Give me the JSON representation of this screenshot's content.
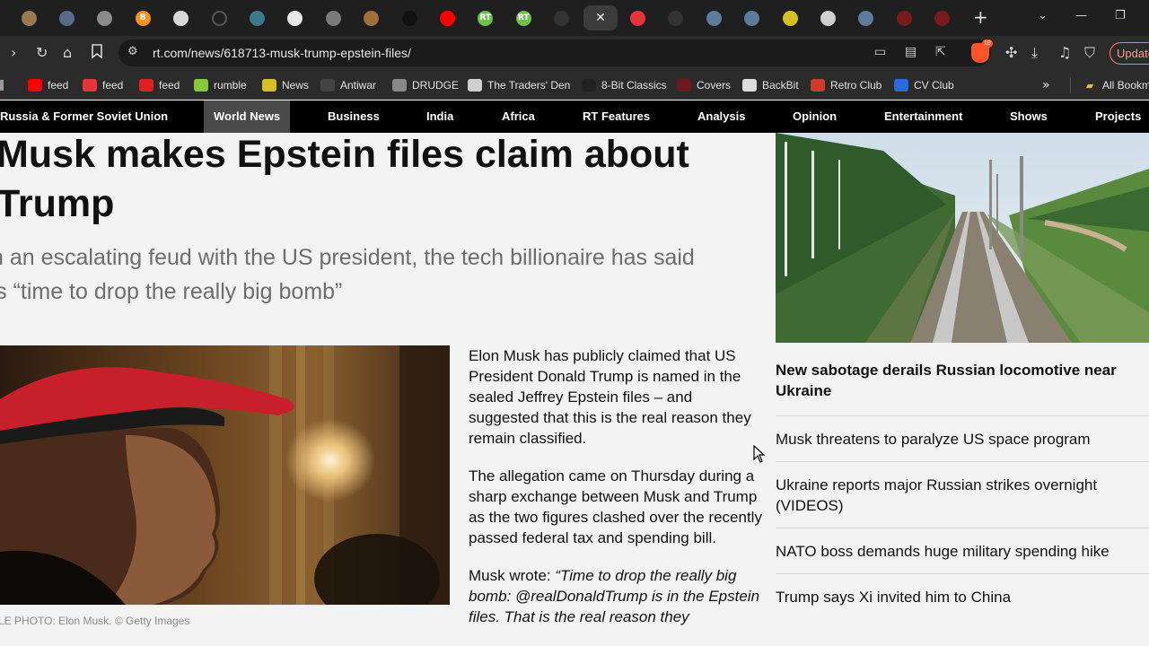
{
  "browser": {
    "tabs": [
      {
        "icon": "planet-icon",
        "color": "#9a7b50",
        "glyph": ""
      },
      {
        "icon": "globe-icon",
        "color": "#5a6a8a",
        "glyph": ""
      },
      {
        "icon": "disc-icon",
        "color": "#8c8c8c",
        "glyph": ""
      },
      {
        "icon": "bitcoin-icon",
        "color": "#f7931a",
        "glyph": "B"
      },
      {
        "icon": "skull-icon",
        "color": "#d8d8d8",
        "glyph": ""
      },
      {
        "icon": "loading-icon",
        "color": "#444444",
        "glyph": ""
      },
      {
        "icon": "earth-icon",
        "color": "#3d7a8a",
        "glyph": ""
      },
      {
        "icon": "hand-icon",
        "color": "#e8e8e8",
        "glyph": ""
      },
      {
        "icon": "trash-icon",
        "color": "#7a7a7a",
        "glyph": ""
      },
      {
        "icon": "bronze-coin-icon",
        "color": "#a0703a",
        "glyph": ""
      },
      {
        "icon": "no-entry-icon",
        "color": "#111111",
        "glyph": ""
      },
      {
        "icon": "youtube-icon",
        "color": "#ff0000",
        "glyph": ""
      },
      {
        "icon": "rt-icon",
        "color": "#6cc24a",
        "glyph": "RT"
      },
      {
        "icon": "rt-icon",
        "color": "#6cc24a",
        "glyph": "RT"
      },
      {
        "icon": "circle-icon",
        "color": "#333333",
        "glyph": ""
      },
      {
        "icon": "close-icon",
        "color": "#3c3c3c",
        "glyph": "✕"
      },
      {
        "icon": "gaming-icon",
        "color": "#e8323c",
        "glyph": ""
      },
      {
        "icon": "circle-icon",
        "color": "#333333",
        "glyph": ""
      },
      {
        "icon": "planet-icon",
        "color": "#5c7c9c",
        "glyph": ""
      },
      {
        "icon": "planet-icon",
        "color": "#5c7c9c",
        "glyph": ""
      },
      {
        "icon": "star-icon",
        "color": "#d4c020",
        "glyph": ""
      },
      {
        "icon": "image-icon",
        "color": "#cfcfcf",
        "glyph": ""
      },
      {
        "icon": "planet-icon",
        "color": "#5c7c9c",
        "glyph": ""
      },
      {
        "icon": "flag-icon",
        "color": "#7a1a1a",
        "glyph": ""
      },
      {
        "icon": "flag-icon",
        "color": "#7a1a1a",
        "glyph": ""
      }
    ],
    "url": "rt.com/news/618713-musk-trump-epstein-files/",
    "brave_badge": "18",
    "update_label": "Update",
    "bookmarks": [
      {
        "label": "feed",
        "icon": "youtube-icon",
        "color": "#ff0000"
      },
      {
        "label": "feed",
        "icon": "gaming-icon",
        "color": "#e8323c"
      },
      {
        "label": "feed",
        "icon": "c-logo-icon",
        "color": "#e02020"
      },
      {
        "label": "rumble",
        "icon": "rumble-icon",
        "color": "#85c742"
      },
      {
        "label": "News",
        "icon": "news-star-icon",
        "color": "#d4c020"
      },
      {
        "label": "Antiwar",
        "icon": "antiwar-icon",
        "color": "#444444"
      },
      {
        "label": "DRUDGE",
        "icon": "drudge-icon",
        "color": "#888888"
      },
      {
        "label": "The Traders' Den",
        "icon": "den-icon",
        "color": "#cfcfcf"
      },
      {
        "label": "8-Bit Classics",
        "icon": "arcade-icon",
        "color": "#222222"
      },
      {
        "label": "Covers",
        "icon": "covers-icon",
        "color": "#6a1a1a"
      },
      {
        "label": "BackBit",
        "icon": "backbit-icon",
        "color": "#dddddd"
      },
      {
        "label": "Retro Club",
        "icon": "retro-club-icon",
        "color": "#d03a2a"
      },
      {
        "label": "CV Club",
        "icon": "cv-club-icon",
        "color": "#2a6adc"
      }
    ],
    "all_bookmarks_label": "All Bookm"
  },
  "site": {
    "nav": [
      "Russia & Former Soviet Union",
      "World News",
      "Business",
      "India",
      "Africa",
      "RT Features",
      "Analysis",
      "Opinion",
      "Entertainment",
      "Shows",
      "Projects"
    ],
    "active_nav": "World News"
  },
  "article": {
    "title_line1": "Musk makes Epstein files claim about",
    "title_line2": "Trump",
    "summary_line1": "n an escalating feud with the US president, the tech billionaire has said",
    "summary_line2": "’s “time to drop the really big bomb”",
    "caption": "LE PHOTO: Elon Musk. © Getty Images",
    "paragraphs": [
      "Elon Musk has publicly claimed that US President Donald Trump is named in the sealed Jeffrey Epstein files – and suggested that this is the real reason they remain classified.",
      "The allegation came on Thursday during a sharp exchange between Musk and Trump as the two figures clashed over the recently passed federal tax and spending bill."
    ],
    "quote_lead": "Musk wrote: ",
    "quote_text": "“Time to drop the really big bomb: @realDonaldTrump is in the Epstein files. That is the real reason they"
  },
  "sidebar": {
    "lead": "New sabotage derails Russian locomotive near Ukraine",
    "items": [
      "Musk threatens to paralyze US space program",
      "Ukraine reports major Russian strikes overnight (VIDEOS)",
      "NATO boss demands huge military spending hike",
      "Trump says Xi invited him to China"
    ]
  }
}
